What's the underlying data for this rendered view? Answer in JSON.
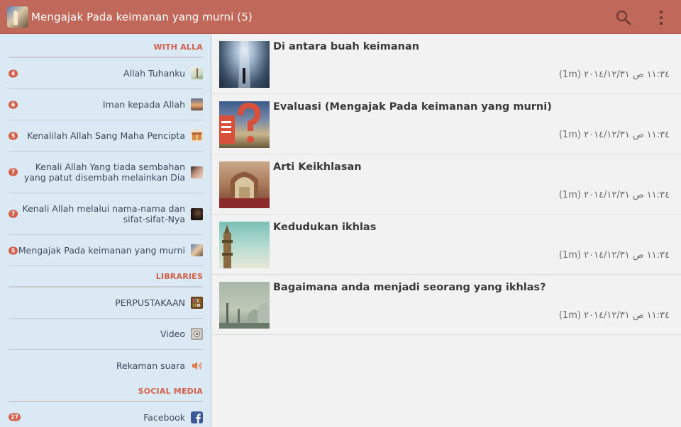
{
  "actionbar": {
    "title": "Mengajak Pada keimanan yang murni (5)",
    "icon": "app-mosque-icon",
    "search_icon": "search-icon",
    "overflow_icon": "overflow-menu-icon",
    "color": "#c0695a"
  },
  "drawer": {
    "sections": [
      {
        "header": "WITH ALLA",
        "items": [
          {
            "badge": "4",
            "label": "Allah Tuhanku",
            "icon": "minaret-icon"
          },
          {
            "badge": "6",
            "label": "Iman kepada Allah",
            "icon": "sunset-icon"
          },
          {
            "badge": "5",
            "label": "Kenalilah Allah Sang Maha Pencipta",
            "icon": "gift-icon"
          },
          {
            "badge": "7",
            "label": "Kenali Allah Yang tiada sembahan yang patut disembah melainkan Dia",
            "icon": "praying-hands-icon"
          },
          {
            "badge": "7",
            "label": "Kenali Allah melalui nama-nama dan sifat-sifat-Nya",
            "icon": "dark-silhouette-icon"
          },
          {
            "badge": "5",
            "label": "Mengajak Pada keimanan yang murni",
            "icon": "mosque-tower-icon"
          }
        ]
      },
      {
        "header": "LIBRARIES",
        "items": [
          {
            "badge": "",
            "label": "PERPUSTAKAAN",
            "icon": "library-icon"
          },
          {
            "badge": "",
            "label": "Video",
            "icon": "video-icon"
          },
          {
            "badge": "",
            "label": "Rekaman suara",
            "icon": "speaker-icon"
          }
        ]
      },
      {
        "header": "SOCIAL MEDIA",
        "items": [
          {
            "badge": "27",
            "label": "Facebook",
            "icon": "facebook-icon"
          }
        ]
      }
    ],
    "badge_color": "#d2604a"
  },
  "posts": [
    {
      "title": "Di antara buah keimanan",
      "meta": "(1m) ١١:٣٤ ص ٢٠١٤/١٢/٣١",
      "thumb": "light-rays-thumb"
    },
    {
      "title": "Evaluasi (Mengajak Pada keimanan yang murni)",
      "meta": "(1m) ١١:٣٤ ص ٢٠١٤/١٢/٣١",
      "thumb": "question-mark-thumb"
    },
    {
      "title": "Arti Keikhlasan",
      "meta": "(1m) ١١:٣٤ ص ٢٠١٤/١٢/٣١",
      "thumb": "mosque-interior-thumb"
    },
    {
      "title": "Kedudukan ikhlas",
      "meta": "(1m) ١١:٣٤ ص ٢٠١٤/١٢/٣١",
      "thumb": "minaret-sky-thumb"
    },
    {
      "title": "Bagaimana anda menjadi seorang yang ikhlas?",
      "meta": "(1m) ١١:٣٤ ص ٢٠١٤/١٢/٣١",
      "thumb": "mosque-domes-thumb"
    }
  ]
}
